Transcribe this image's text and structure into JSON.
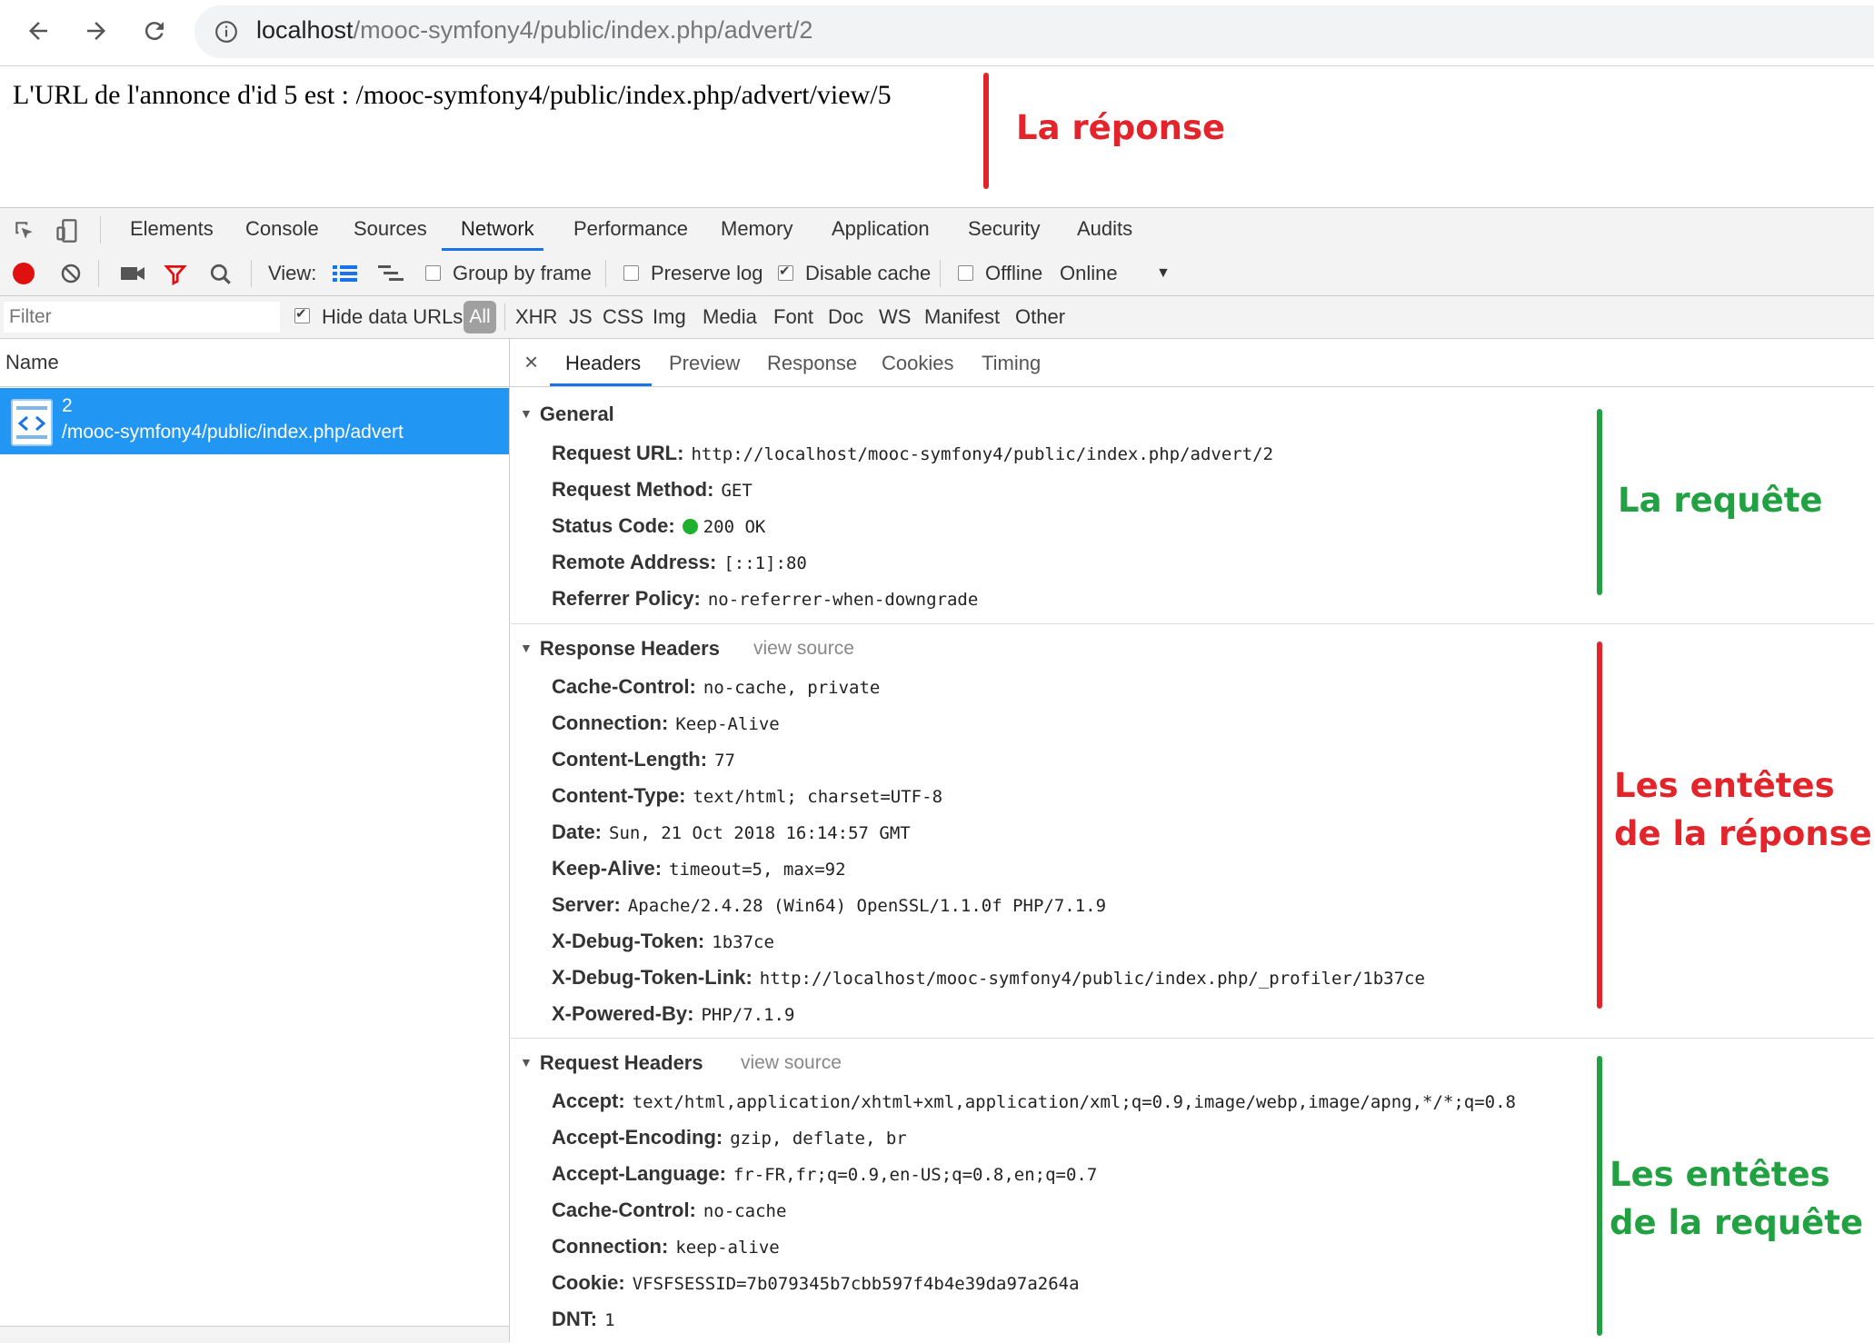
{
  "browser": {
    "url_host": "localhost",
    "url_path": "/mooc-symfony4/public/index.php/advert/2",
    "back_icon": "arrow-left",
    "forward_icon": "arrow-right",
    "reload_icon": "reload",
    "info_icon": "info-circle"
  },
  "page": {
    "text": "L'URL de l'annonce d'id 5 est : /mooc-symfony4/public/index.php/advert/view/5"
  },
  "annotations": {
    "reponse": "La réponse",
    "requete": "La requête",
    "entetes_reponse_1": "Les entêtes",
    "entetes_reponse_2": "de la réponse",
    "entetes_requete_1": "Les entêtes",
    "entetes_requete_2": "de la requête",
    "red": "#e3242b",
    "green": "#21a142"
  },
  "devtools": {
    "tabs": [
      "Elements",
      "Console",
      "Sources",
      "Network",
      "Performance",
      "Memory",
      "Application",
      "Security",
      "Audits"
    ],
    "active_tab": "Network",
    "toolbar": {
      "view_label": "View:",
      "group_by_frame": "Group by frame",
      "preserve_log": "Preserve log",
      "disable_cache": "Disable cache",
      "offline": "Offline",
      "online": "Online"
    },
    "filter": {
      "placeholder": "Filter",
      "hide_data_urls": "Hide data URLs",
      "types": [
        "All",
        "XHR",
        "JS",
        "CSS",
        "Img",
        "Media",
        "Font",
        "Doc",
        "WS",
        "Manifest",
        "Other"
      ]
    },
    "name_header": "Name",
    "request": {
      "name": "2",
      "path": "/mooc-symfony4/public/index.php/advert"
    },
    "detail_tabs": [
      "Headers",
      "Preview",
      "Response",
      "Cookies",
      "Timing"
    ],
    "close": "×",
    "general": {
      "title": "General",
      "rows": [
        {
          "k": "Request URL:",
          "v": "http://localhost/mooc-symfony4/public/index.php/advert/2"
        },
        {
          "k": "Request Method:",
          "v": "GET"
        },
        {
          "k": "Status Code:",
          "v": "200 OK"
        },
        {
          "k": "Remote Address:",
          "v": "[::1]:80"
        },
        {
          "k": "Referrer Policy:",
          "v": "no-referrer-when-downgrade"
        }
      ]
    },
    "response_headers": {
      "title": "Response Headers",
      "view_source": "view source",
      "rows": [
        {
          "k": "Cache-Control:",
          "v": "no-cache, private"
        },
        {
          "k": "Connection:",
          "v": "Keep-Alive"
        },
        {
          "k": "Content-Length:",
          "v": "77"
        },
        {
          "k": "Content-Type:",
          "v": "text/html; charset=UTF-8"
        },
        {
          "k": "Date:",
          "v": "Sun, 21 Oct 2018 16:14:57 GMT"
        },
        {
          "k": "Keep-Alive:",
          "v": "timeout=5, max=92"
        },
        {
          "k": "Server:",
          "v": "Apache/2.4.28 (Win64) OpenSSL/1.1.0f PHP/7.1.9"
        },
        {
          "k": "X-Debug-Token:",
          "v": "1b37ce"
        },
        {
          "k": "X-Debug-Token-Link:",
          "v": "http://localhost/mooc-symfony4/public/index.php/_profiler/1b37ce"
        },
        {
          "k": "X-Powered-By:",
          "v": "PHP/7.1.9"
        }
      ]
    },
    "request_headers": {
      "title": "Request Headers",
      "view_source": "view source",
      "rows": [
        {
          "k": "Accept:",
          "v": "text/html,application/xhtml+xml,application/xml;q=0.9,image/webp,image/apng,*/*;q=0.8"
        },
        {
          "k": "Accept-Encoding:",
          "v": "gzip, deflate, br"
        },
        {
          "k": "Accept-Language:",
          "v": "fr-FR,fr;q=0.9,en-US;q=0.8,en;q=0.7"
        },
        {
          "k": "Cache-Control:",
          "v": "no-cache"
        },
        {
          "k": "Connection:",
          "v": "keep-alive"
        },
        {
          "k": "Cookie:",
          "v": "VFSFSESSID=7b079345b7cbb597f4b4e39da97a264a"
        },
        {
          "k": "DNT:",
          "v": "1"
        }
      ]
    }
  }
}
